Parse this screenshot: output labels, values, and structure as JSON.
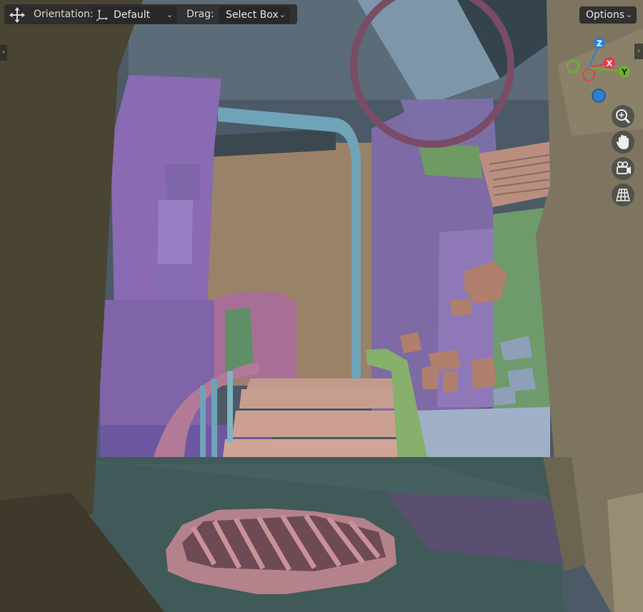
{
  "header": {
    "orientation_label": "Orientation:",
    "orientation_value": "Default",
    "drag_label": "Drag:",
    "drag_value": "Select Box",
    "options_label": "Options"
  },
  "gizmo": {
    "axes": [
      {
        "name": "Z",
        "color": "#2f7fd0"
      },
      {
        "name": "X",
        "color": "#e8384f"
      },
      {
        "name": "Y",
        "color": "#6cb52d"
      }
    ]
  },
  "nav_buttons": [
    {
      "icon": "zoom-icon"
    },
    {
      "icon": "hand-pan-icon"
    },
    {
      "icon": "camera-view-icon"
    },
    {
      "icon": "grid-perspective-icon"
    }
  ],
  "colors": {
    "header_bg": "#2a2a2a",
    "dropdown_bg": "#282828",
    "header_text": "#d8d8d8"
  }
}
